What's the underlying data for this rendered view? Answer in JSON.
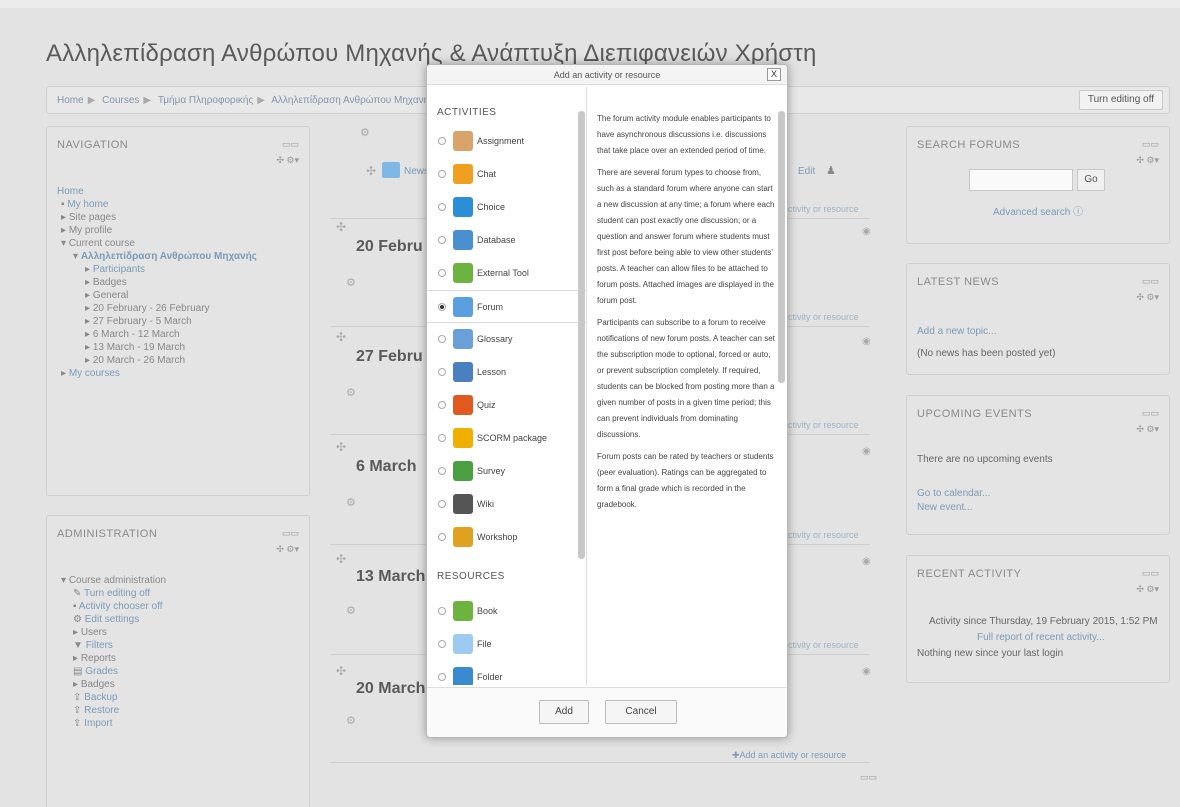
{
  "page": {
    "title": "Αλληλεπίδραση Ανθρώπου Μηχανής & Ανάπτυξη Διεπιφανειών Χρήστη",
    "breadcrumb": [
      "Home",
      "Courses",
      "Τμήμα Πληροφορικής",
      "Αλληλεπίδραση Ανθρώπου Μηχανής"
    ],
    "turn_editing_off": "Turn editing off"
  },
  "navigation": {
    "title": "NAVIGATION",
    "home": "Home",
    "my_home": "My home",
    "site_pages": "Site pages",
    "my_profile": "My profile",
    "current_course": "Current course",
    "course_name": "Αλληλεπίδραση Ανθρώπου Μηχανής",
    "course_items": [
      "Participants",
      "Badges",
      "General",
      "20 February - 26 February",
      "27 February - 5 March",
      "6 March - 12 March",
      "13 March - 19 March",
      "20 March - 26 March"
    ],
    "my_courses": "My courses"
  },
  "administration": {
    "title": "ADMINISTRATION",
    "course_admin": "Course administration",
    "items": [
      "Turn editing off",
      "Activity chooser off",
      "Edit settings",
      "Users",
      "Filters",
      "Reports",
      "Grades",
      "Badges",
      "Backup",
      "Restore",
      "Import"
    ]
  },
  "center": {
    "news_item": "News f",
    "edit_label": "Edit",
    "add_activity": "Add an activity or resource",
    "add_activity_short": "ctivity or resource",
    "sections": [
      "20 Febru",
      "27 Febru",
      "6 March",
      "13 March",
      "20 March"
    ]
  },
  "dialog": {
    "title": "Add an activity or resource",
    "close": "X",
    "activities_heading": "ACTIVITIES",
    "resources_heading": "RESOURCES",
    "activities": [
      {
        "label": "Assignment",
        "icon": "assignment-icon",
        "color": "#d9a36a"
      },
      {
        "label": "Chat",
        "icon": "chat-icon",
        "color": "#f0a020"
      },
      {
        "label": "Choice",
        "icon": "choice-icon",
        "color": "#2b8fd8"
      },
      {
        "label": "Database",
        "icon": "database-icon",
        "color": "#4a8fd0"
      },
      {
        "label": "External Tool",
        "icon": "external-tool-icon",
        "color": "#6cb33f"
      },
      {
        "label": "Forum",
        "icon": "forum-icon",
        "color": "#5aa0e0"
      },
      {
        "label": "Glossary",
        "icon": "glossary-icon",
        "color": "#6aa0d8"
      },
      {
        "label": "Lesson",
        "icon": "lesson-icon",
        "color": "#4a7fc0"
      },
      {
        "label": "Quiz",
        "icon": "quiz-icon",
        "color": "#e05a20"
      },
      {
        "label": "SCORM package",
        "icon": "scorm-icon",
        "color": "#f0b000"
      },
      {
        "label": "Survey",
        "icon": "survey-icon",
        "color": "#4aa040"
      },
      {
        "label": "Wiki",
        "icon": "wiki-icon",
        "color": "#555555"
      },
      {
        "label": "Workshop",
        "icon": "workshop-icon",
        "color": "#e0a020"
      }
    ],
    "resources": [
      {
        "label": "Book",
        "icon": "book-icon",
        "color": "#6cb33f"
      },
      {
        "label": "File",
        "icon": "file-icon",
        "color": "#9ccaf0"
      },
      {
        "label": "Folder",
        "icon": "folder-icon",
        "color": "#3a8ad0"
      }
    ],
    "selected": "Forum",
    "description": [
      "The forum activity module enables participants to have asynchronous discussions i.e. discussions that take place over an extended period of time.",
      "There are several forum types to choose from, such as a standard forum where anyone can start a new discussion at any time; a forum where each student can post exactly one discussion; or a question and answer forum where students must first post before being able to view other students' posts. A teacher can allow files to be attached to forum posts. Attached images are displayed in the forum post.",
      "Participants can subscribe to a forum to receive notifications of new forum posts. A teacher can set the subscription mode to optional, forced or auto, or prevent subscription completely. If required, students can be blocked from posting more than a given number of posts in a given time period; this can prevent individuals from dominating discussions.",
      "Forum posts can be rated by teachers or students (peer evaluation). Ratings can be aggregated to form a final grade which is recorded in the gradebook."
    ],
    "add_button": "Add",
    "cancel_button": "Cancel"
  },
  "search_forums": {
    "title": "SEARCH FORUMS",
    "go": "Go",
    "advanced": "Advanced search"
  },
  "latest_news": {
    "title": "LATEST NEWS",
    "add_topic": "Add a new topic...",
    "none": "(No news has been posted yet)"
  },
  "upcoming_events": {
    "title": "UPCOMING EVENTS",
    "none": "There are no upcoming events",
    "calendar": "Go to calendar...",
    "new_event": "New event..."
  },
  "recent_activity": {
    "title": "RECENT ACTIVITY",
    "since": "Activity since Thursday, 19 February 2015, 1:52 PM",
    "full_report": "Full report of recent activity...",
    "nothing": "Nothing new since your last login"
  }
}
